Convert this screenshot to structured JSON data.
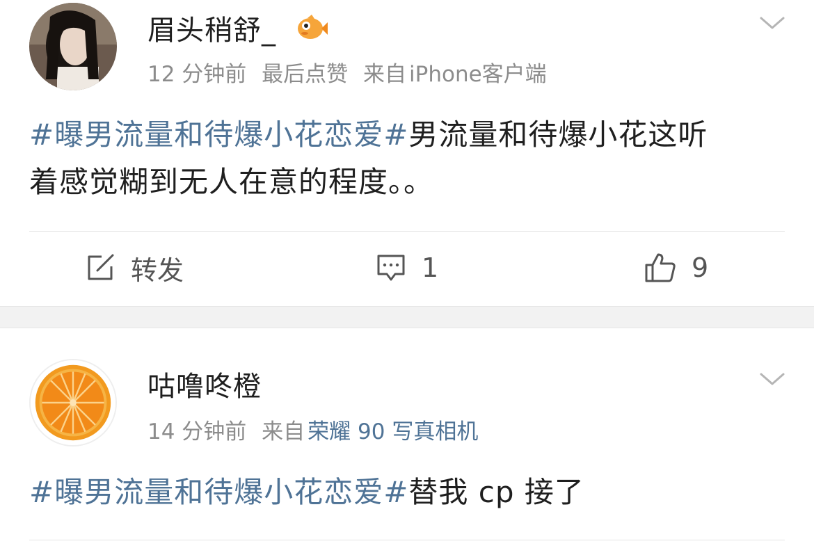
{
  "posts": [
    {
      "username": "眉头稍舒_",
      "time": "12 分钟前",
      "note": "最后点赞",
      "source_prefix": "来自",
      "source": "iPhone客户端",
      "topic": "#曝男流量和待爆小花恋爱#",
      "text_line1_rest": "男流量和待爆小花这听",
      "text_line2": "着感觉糊到无人在意的程度。。",
      "actions": {
        "repost_label": "转发",
        "comment_count": "1",
        "like_count": "9"
      }
    },
    {
      "username": "咕噜咚橙",
      "time": "14 分钟前",
      "source_prefix": "来自",
      "source": "荣耀 90 写真相机",
      "topic": "#曝男流量和待爆小花恋爱#",
      "text_rest": "替我 cp 接了"
    }
  ],
  "colors": {
    "topic": "#4f7396",
    "meta": "#8c8c8c",
    "separator": "#f2f2f2"
  },
  "icons": [
    "fish-badge-icon",
    "chevron-down-icon",
    "repost-icon",
    "comment-icon",
    "like-icon",
    "orange-avatar"
  ]
}
